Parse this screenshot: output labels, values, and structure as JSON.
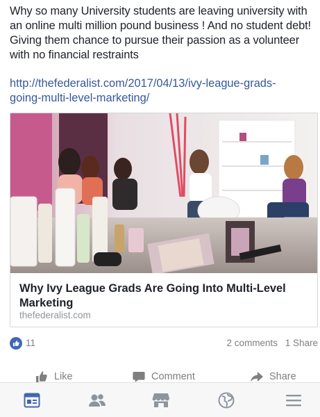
{
  "post": {
    "text": "Why so many University students are leaving university with an online multi million pound business ! And no student debt! Giving them chance to pursue their passion as a volunteer with no financial restraints",
    "link": "http://thefederalist.com/2017/04/13/ivy-league-grads-going-multi-level-marketing/"
  },
  "link_card": {
    "title": "Why Ivy League Grads Are Going Into Multi-Level Marketing",
    "domain": "thefederalist.com",
    "image": "photo of women at a product party with cosmetics on a table"
  },
  "reactions": {
    "icon": "like-thumb-icon",
    "like_count": "11",
    "comments": "2 comments",
    "shares": "1 Share",
    "accent_color": "#4267b2"
  },
  "actions": {
    "like": "Like",
    "comment": "Comment",
    "share": "Share"
  },
  "tabbar": {
    "items": [
      "news-feed-icon",
      "friends-icon",
      "marketplace-icon",
      "notifications-globe-icon",
      "menu-icon"
    ],
    "active_color": "#4267b2",
    "inactive_color": "#8d949e"
  }
}
